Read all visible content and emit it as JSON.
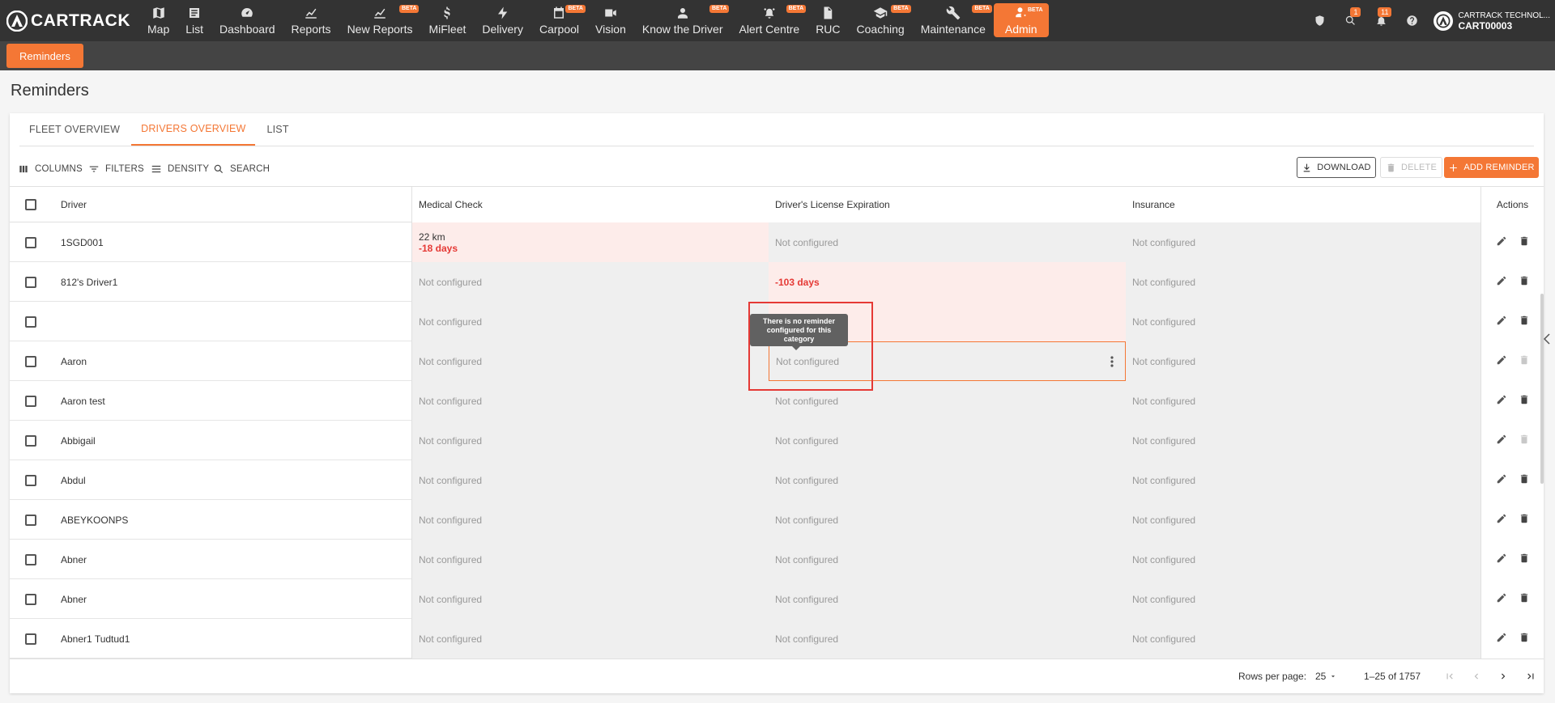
{
  "brand": {
    "name": "CARTRACK",
    "accent": "#f47735"
  },
  "nav": {
    "items": [
      {
        "label": "Map",
        "icon": "map-icon",
        "beta": ""
      },
      {
        "label": "List",
        "icon": "list-icon",
        "beta": ""
      },
      {
        "label": "Dashboard",
        "icon": "dashboard-icon",
        "beta": ""
      },
      {
        "label": "Reports",
        "icon": "reports-icon",
        "beta": ""
      },
      {
        "label": "New Reports",
        "icon": "new-reports-icon",
        "beta": "BETA"
      },
      {
        "label": "MiFleet",
        "icon": "dollar-icon",
        "beta": ""
      },
      {
        "label": "Delivery",
        "icon": "lightning-icon",
        "beta": ""
      },
      {
        "label": "Carpool",
        "icon": "calendar-icon",
        "beta": "BETA"
      },
      {
        "label": "Vision",
        "icon": "camera-icon",
        "beta": ""
      },
      {
        "label": "Know the Driver",
        "icon": "person-icon",
        "beta": "BETA"
      },
      {
        "label": "Alert Centre",
        "icon": "alert-icon",
        "beta": "BETA"
      },
      {
        "label": "RUC",
        "icon": "document-icon",
        "beta": ""
      },
      {
        "label": "Coaching",
        "icon": "graduation-icon",
        "beta": "BETA"
      },
      {
        "label": "Maintenance",
        "icon": "tools-icon",
        "beta": "BETA"
      },
      {
        "label": "Admin",
        "icon": "admin-icon",
        "beta": "BETA"
      }
    ],
    "right": {
      "search_badge": "1",
      "notifications_badge": "11",
      "account_name": "CARTRACK TECHNOL...",
      "account_id": "CART00003"
    }
  },
  "subnav": {
    "active": "Reminders"
  },
  "page": {
    "title": "Reminders"
  },
  "tabs": [
    "FLEET OVERVIEW",
    "DRIVERS OVERVIEW",
    "LIST"
  ],
  "toolbar": {
    "columns": "COLUMNS",
    "filters": "FILTERS",
    "density": "DENSITY",
    "search": "SEARCH",
    "download": "DOWNLOAD",
    "delete": "DELETE",
    "add": "ADD REMINDER"
  },
  "table": {
    "headers": {
      "driver": "Driver",
      "medical": "Medical Check",
      "license": "Driver's License Expiration",
      "insurance": "Insurance",
      "actions": "Actions"
    },
    "rows": [
      {
        "driver": "1SGD001",
        "medical": "22 km",
        "medical_days": "-18 days",
        "license": "Not configured",
        "insurance": "Not configured"
      },
      {
        "driver": "812's Driver1",
        "medical": "Not configured",
        "license": "-103 days",
        "insurance": "Not configured"
      },
      {
        "driver": "",
        "medical": "Not configured",
        "license": "",
        "insurance": "Not configured"
      },
      {
        "driver": "Aaron",
        "medical": "Not configured",
        "license": "Not configured",
        "insurance": "Not configured"
      },
      {
        "driver": "Aaron test",
        "medical": "Not configured",
        "license": "Not configured",
        "insurance": "Not configured"
      },
      {
        "driver": "Abbigail",
        "medical": "Not configured",
        "license": "Not configured",
        "insurance": "Not configured"
      },
      {
        "driver": "Abdul",
        "medical": "Not configured",
        "license": "Not configured",
        "insurance": "Not configured"
      },
      {
        "driver": "ABEYKOONPS",
        "medical": "Not configured",
        "license": "Not configured",
        "insurance": "Not configured"
      },
      {
        "driver": "Abner",
        "medical": "Not configured",
        "license": "Not configured",
        "insurance": "Not configured"
      },
      {
        "driver": "Abner",
        "medical": "Not configured",
        "license": "Not configured",
        "insurance": "Not configured"
      },
      {
        "driver": "Abner1 Tudtud1",
        "medical": "Not configured",
        "license": "Not configured",
        "insurance": "Not configured"
      }
    ],
    "tooltip": "There is no reminder configured for this category"
  },
  "footer": {
    "rows_per_page_label": "Rows per page:",
    "rows_per_page": "25",
    "range": "1–25 of 1757"
  }
}
